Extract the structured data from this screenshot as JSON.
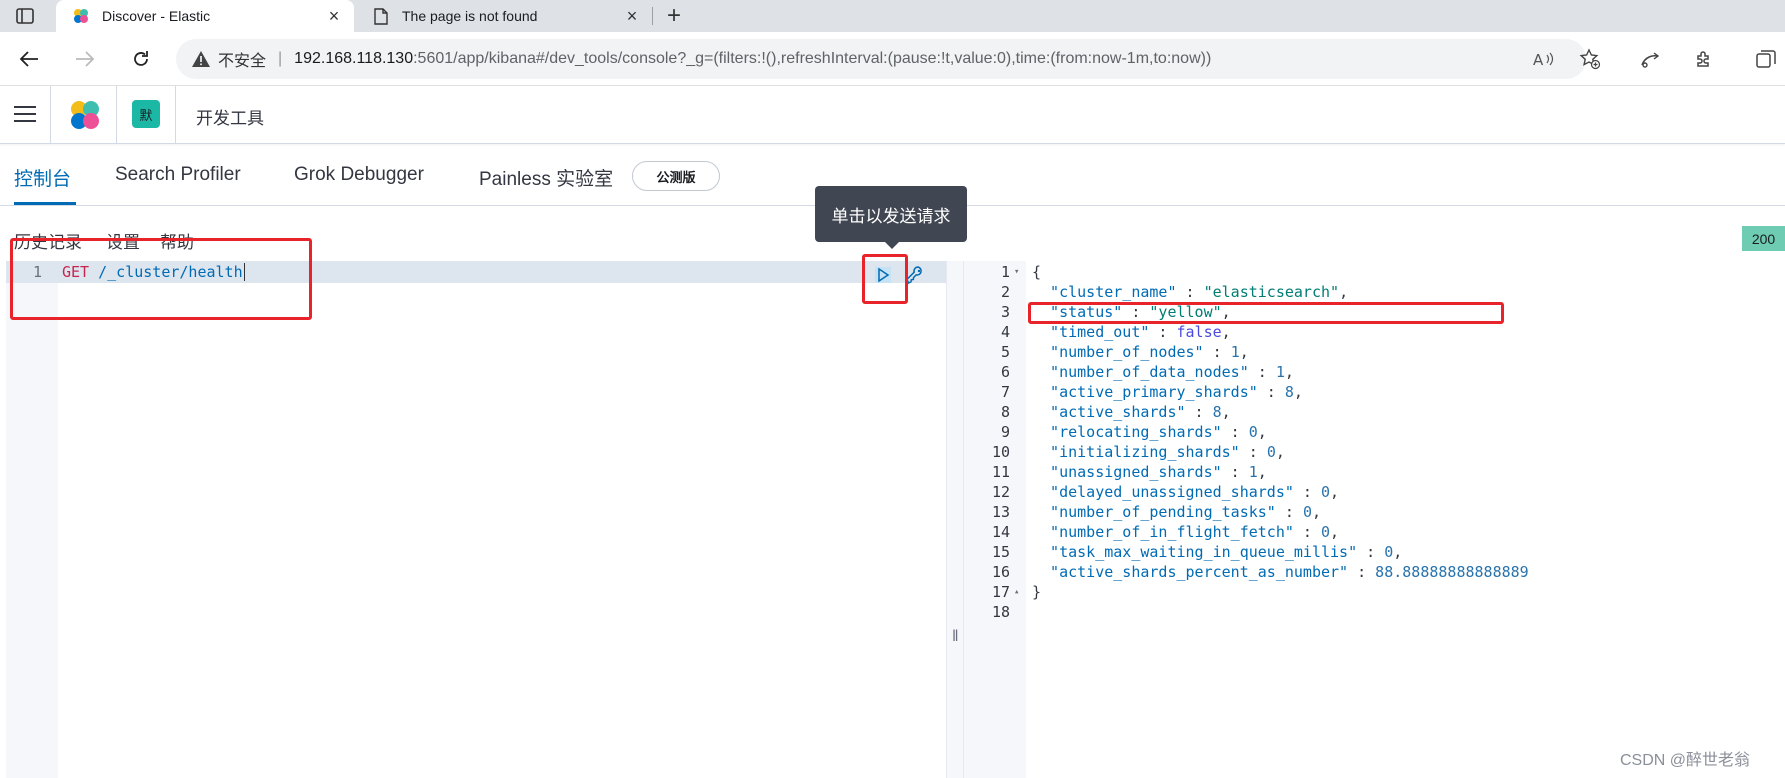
{
  "browser": {
    "tabs": [
      {
        "title": "Discover - Elastic",
        "icon": "elastic-logo-icon",
        "active": true
      },
      {
        "title": "The page is not found",
        "icon": "document-icon",
        "active": false
      }
    ],
    "address": {
      "security_label": "不安全",
      "host": "192.168.118.130",
      "rest": ":5601/app/kibana#/dev_tools/console?_g=(filters:!(),refreshInterval:(pause:!t,value:0),time:(from:now-1m,to:now))"
    }
  },
  "kibana": {
    "space_initial": "默",
    "breadcrumb": "开发工具",
    "colors": {
      "accent": "#006bb4",
      "space": "#1bb9a5",
      "status": "#6dccb1"
    }
  },
  "devtools": {
    "tabs": [
      "控制台",
      "Search Profiler",
      "Grok Debugger",
      "Painless 实验室"
    ],
    "beta_label": "公测版",
    "menu": [
      "历史记录",
      "设置",
      "帮助"
    ],
    "tooltip": "单击以发送请求",
    "status_code": "200"
  },
  "editor": {
    "line_number": "1",
    "method": "GET",
    "path": "/_cluster/health"
  },
  "output": {
    "lines": [
      {
        "n": "1",
        "fold": "▾",
        "parts": [
          {
            "t": "{",
            "c": "j-punc"
          }
        ]
      },
      {
        "n": "2",
        "parts": [
          {
            "t": "  \"cluster_name\"",
            "c": "j-key"
          },
          {
            "t": " : ",
            "c": "j-punc"
          },
          {
            "t": "\"elasticsearch\"",
            "c": "j-str"
          },
          {
            "t": ",",
            "c": "j-punc"
          }
        ]
      },
      {
        "n": "3",
        "parts": [
          {
            "t": "  \"status\"",
            "c": "j-key"
          },
          {
            "t": " : ",
            "c": "j-punc"
          },
          {
            "t": "\"yellow\"",
            "c": "j-str"
          },
          {
            "t": ",",
            "c": "j-punc"
          }
        ]
      },
      {
        "n": "4",
        "parts": [
          {
            "t": "  \"timed_out\"",
            "c": "j-key"
          },
          {
            "t": " : ",
            "c": "j-punc"
          },
          {
            "t": "false",
            "c": "j-bool"
          },
          {
            "t": ",",
            "c": "j-punc"
          }
        ]
      },
      {
        "n": "5",
        "parts": [
          {
            "t": "  \"number_of_nodes\"",
            "c": "j-key"
          },
          {
            "t": " : ",
            "c": "j-punc"
          },
          {
            "t": "1",
            "c": "j-num"
          },
          {
            "t": ",",
            "c": "j-punc"
          }
        ]
      },
      {
        "n": "6",
        "parts": [
          {
            "t": "  \"number_of_data_nodes\"",
            "c": "j-key"
          },
          {
            "t": " : ",
            "c": "j-punc"
          },
          {
            "t": "1",
            "c": "j-num"
          },
          {
            "t": ",",
            "c": "j-punc"
          }
        ]
      },
      {
        "n": "7",
        "parts": [
          {
            "t": "  \"active_primary_shards\"",
            "c": "j-key"
          },
          {
            "t": " : ",
            "c": "j-punc"
          },
          {
            "t": "8",
            "c": "j-num"
          },
          {
            "t": ",",
            "c": "j-punc"
          }
        ]
      },
      {
        "n": "8",
        "parts": [
          {
            "t": "  \"active_shards\"",
            "c": "j-key"
          },
          {
            "t": " : ",
            "c": "j-punc"
          },
          {
            "t": "8",
            "c": "j-num"
          },
          {
            "t": ",",
            "c": "j-punc"
          }
        ]
      },
      {
        "n": "9",
        "parts": [
          {
            "t": "  \"relocating_shards\"",
            "c": "j-key"
          },
          {
            "t": " : ",
            "c": "j-punc"
          },
          {
            "t": "0",
            "c": "j-num"
          },
          {
            "t": ",",
            "c": "j-punc"
          }
        ]
      },
      {
        "n": "10",
        "parts": [
          {
            "t": "  \"initializing_shards\"",
            "c": "j-key"
          },
          {
            "t": " : ",
            "c": "j-punc"
          },
          {
            "t": "0",
            "c": "j-num"
          },
          {
            "t": ",",
            "c": "j-punc"
          }
        ]
      },
      {
        "n": "11",
        "parts": [
          {
            "t": "  \"unassigned_shards\"",
            "c": "j-key"
          },
          {
            "t": " : ",
            "c": "j-punc"
          },
          {
            "t": "1",
            "c": "j-num"
          },
          {
            "t": ",",
            "c": "j-punc"
          }
        ]
      },
      {
        "n": "12",
        "parts": [
          {
            "t": "  \"delayed_unassigned_shards\"",
            "c": "j-key"
          },
          {
            "t": " : ",
            "c": "j-punc"
          },
          {
            "t": "0",
            "c": "j-num"
          },
          {
            "t": ",",
            "c": "j-punc"
          }
        ]
      },
      {
        "n": "13",
        "parts": [
          {
            "t": "  \"number_of_pending_tasks\"",
            "c": "j-key"
          },
          {
            "t": " : ",
            "c": "j-punc"
          },
          {
            "t": "0",
            "c": "j-num"
          },
          {
            "t": ",",
            "c": "j-punc"
          }
        ]
      },
      {
        "n": "14",
        "parts": [
          {
            "t": "  \"number_of_in_flight_fetch\"",
            "c": "j-key"
          },
          {
            "t": " : ",
            "c": "j-punc"
          },
          {
            "t": "0",
            "c": "j-num"
          },
          {
            "t": ",",
            "c": "j-punc"
          }
        ]
      },
      {
        "n": "15",
        "parts": [
          {
            "t": "  \"task_max_waiting_in_queue_millis\"",
            "c": "j-key"
          },
          {
            "t": " : ",
            "c": "j-punc"
          },
          {
            "t": "0",
            "c": "j-num"
          },
          {
            "t": ",",
            "c": "j-punc"
          }
        ]
      },
      {
        "n": "16",
        "parts": [
          {
            "t": "  \"active_shards_percent_as_number\"",
            "c": "j-key"
          },
          {
            "t": " : ",
            "c": "j-punc"
          },
          {
            "t": "88.88888888888889",
            "c": "j-num"
          }
        ]
      },
      {
        "n": "17",
        "fold": "▴",
        "parts": [
          {
            "t": "}",
            "c": "j-punc"
          }
        ]
      },
      {
        "n": "18",
        "parts": []
      }
    ]
  },
  "watermark": "CSDN @醉世老翁"
}
